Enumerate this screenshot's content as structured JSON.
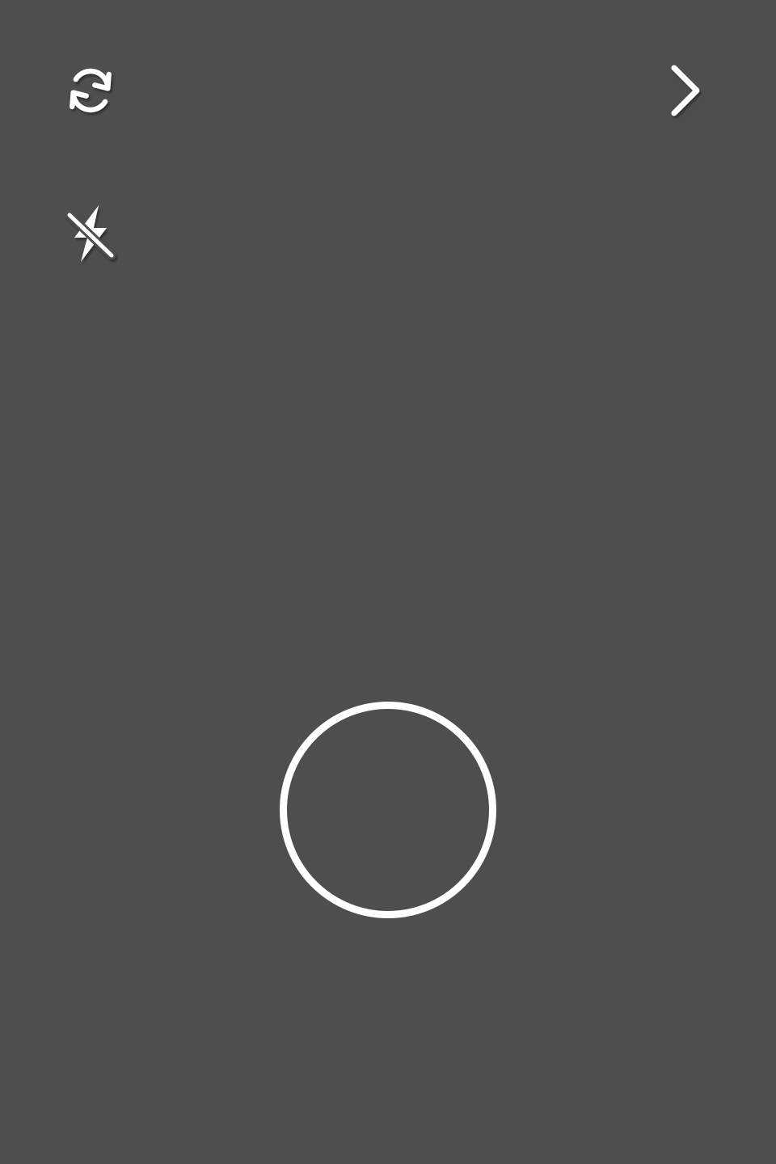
{
  "camera": {
    "background_color": "#4e4e4e",
    "icon_color": "#ffffff",
    "controls": {
      "switch_camera": {
        "icon": "switch-camera-icon"
      },
      "flash": {
        "icon": "flash-off-icon",
        "state": "off"
      },
      "next": {
        "icon": "chevron-right-icon"
      },
      "shutter": {
        "icon": "shutter-ring"
      }
    }
  }
}
